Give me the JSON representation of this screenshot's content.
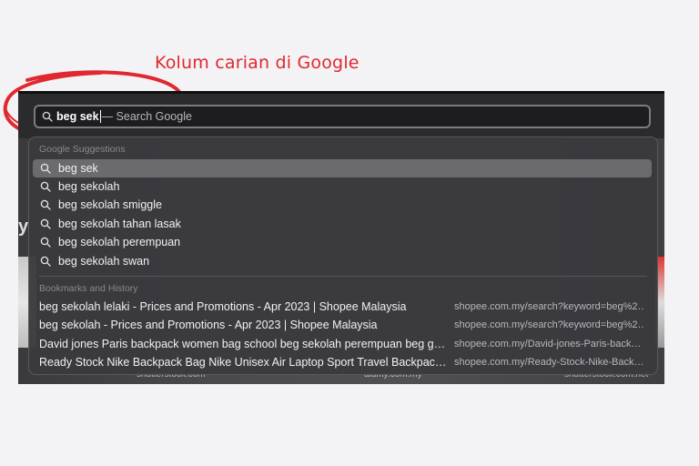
{
  "annotation": {
    "text": "Kolum carian di Google",
    "color": "#e0282e"
  },
  "search": {
    "typed": "beg sek",
    "hint": "— Search Google",
    "icon": "search-icon"
  },
  "suggestions": {
    "title": "Google Suggestions",
    "items": [
      {
        "label": "beg sek",
        "selected": true
      },
      {
        "label": "beg sekolah"
      },
      {
        "label": "beg sekolah smiggle"
      },
      {
        "label": "beg sekolah tahan lasak"
      },
      {
        "label": "beg sekolah perempuan"
      },
      {
        "label": "beg sekolah swan"
      }
    ]
  },
  "history": {
    "title": "Bookmarks and History",
    "items": [
      {
        "title": "beg sekolah lelaki - Prices and Promotions - Apr 2023 | Shopee Malaysia",
        "url": "shopee.com.my/search?keyword=beg%2…"
      },
      {
        "title": "beg sekolah - Prices and Promotions - Apr 2023 | Shopee Malaysia",
        "url": "shopee.com.my/search?keyword=beg%2…"
      },
      {
        "title": "David jones Paris backpack women bag school beg sekolah perempuan beg g…",
        "url": "shopee.com.my/David-jones-Paris-back…"
      },
      {
        "title": "Ready Stock Nike Backpack Bag Nike Unisex Air Laptop Sport Travel Backpac…",
        "url": "shopee.com.my/Ready-Stock-Nike-Back…"
      }
    ]
  },
  "background": {
    "letter": "y",
    "footer": [
      "shutterstock.com",
      "alamy.com.my",
      "shutterstock.com.net"
    ]
  }
}
